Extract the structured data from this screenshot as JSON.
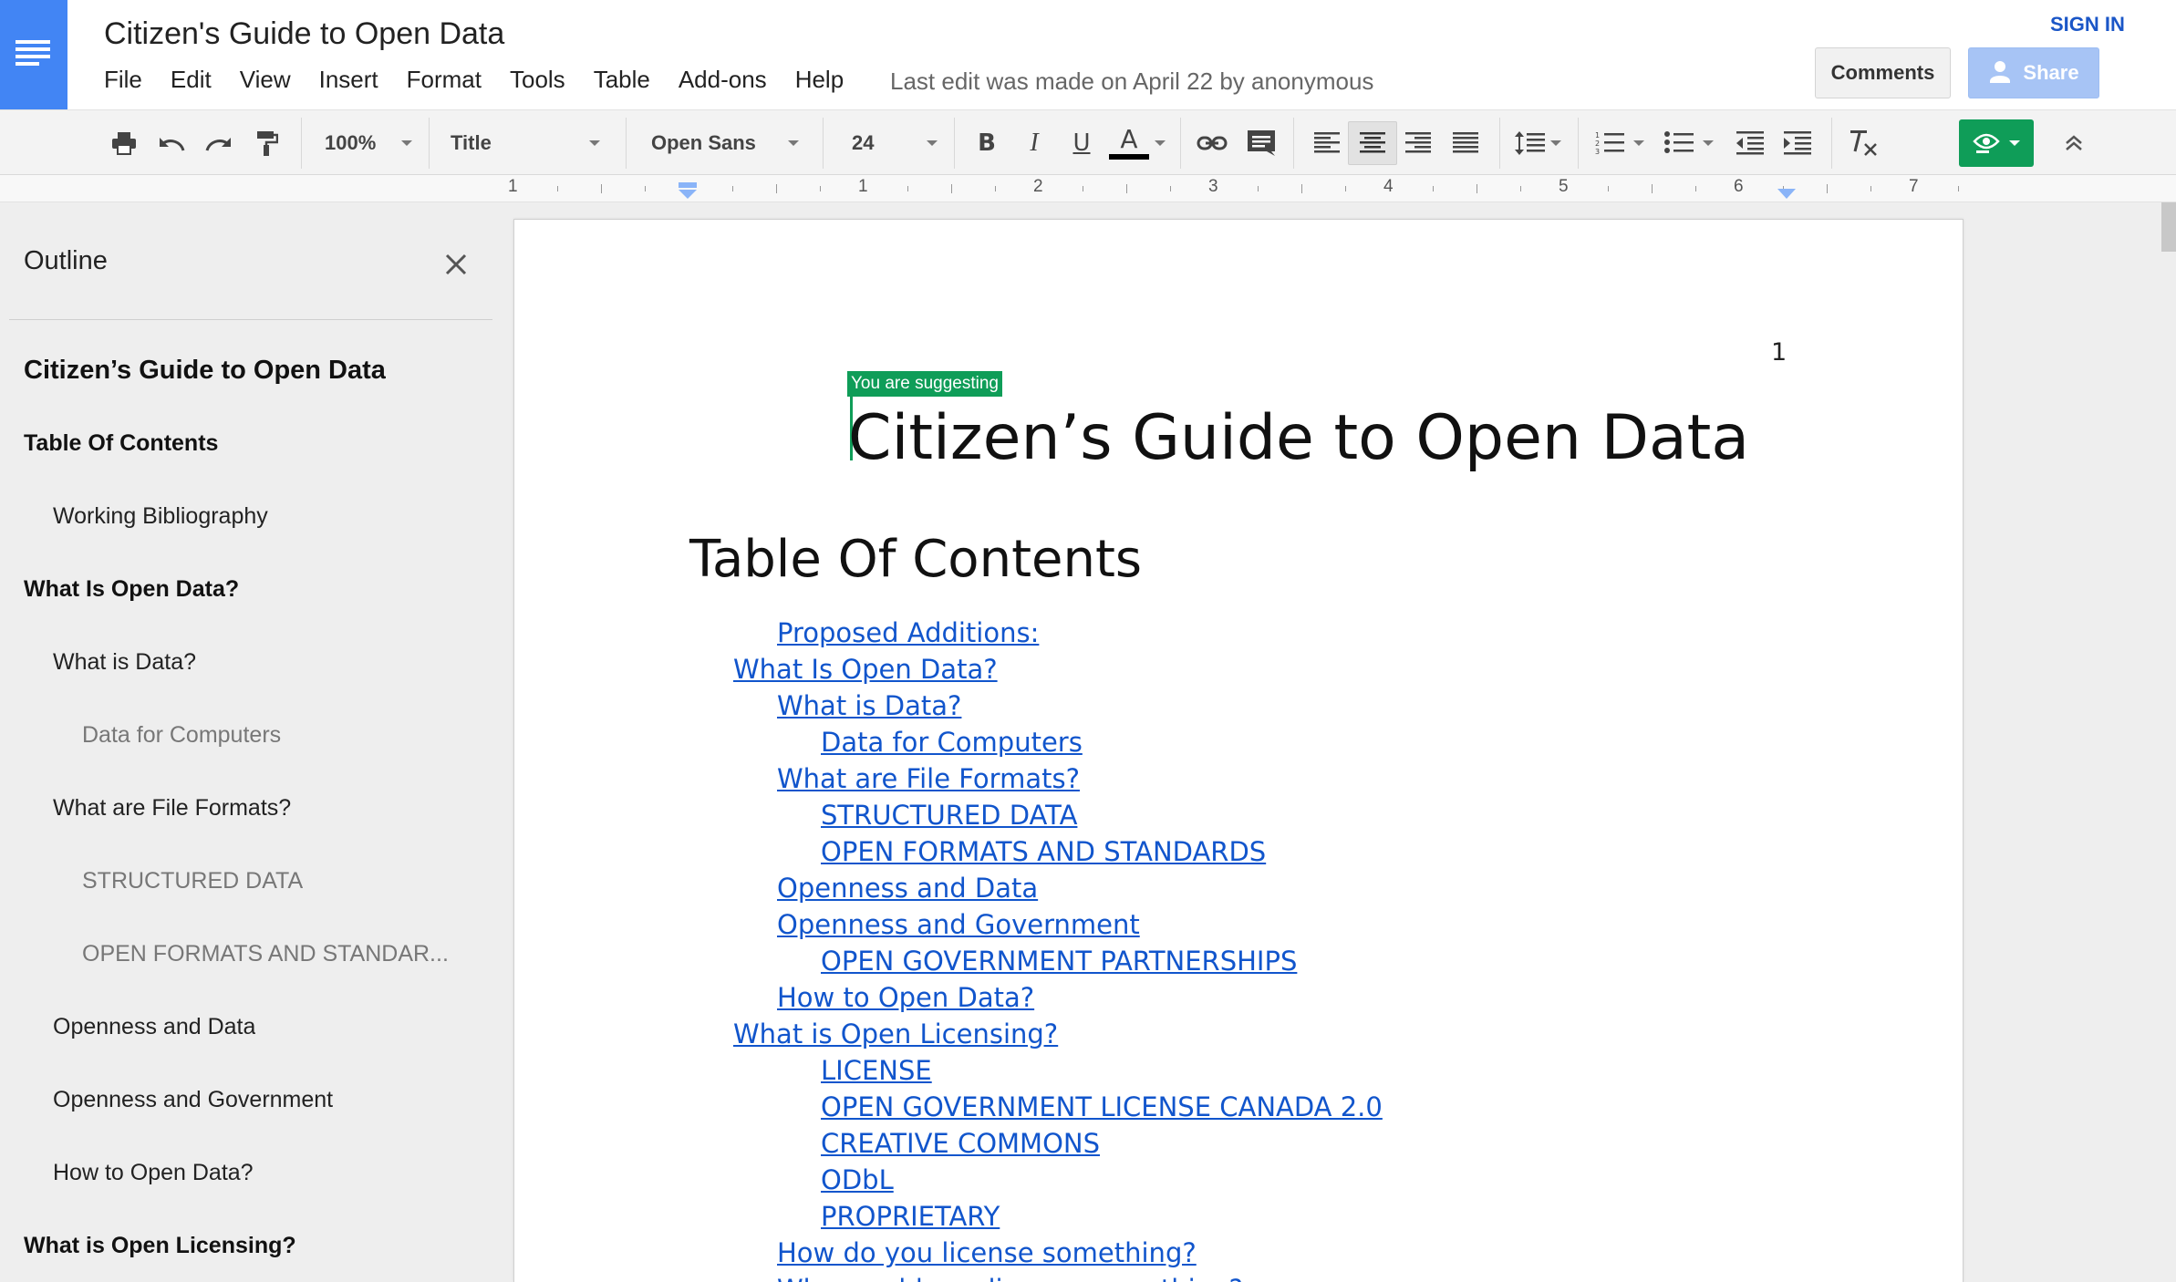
{
  "app": {
    "title": "Citizen's Guide to Open Data",
    "menu": [
      "File",
      "Edit",
      "View",
      "Insert",
      "Format",
      "Tools",
      "Table",
      "Add-ons",
      "Help"
    ],
    "last_edit": "Last edit was made on April 22 by anonymous",
    "sign_in": "SIGN IN",
    "comments_label": "Comments",
    "share_label": "Share",
    "logo_icon": "docs-lines-icon",
    "accent_color": "#4285f4",
    "suggest_color": "#0f9d58",
    "link_color": "#1155cc"
  },
  "toolbar": {
    "zoom": "100%",
    "style": "Title",
    "font": "Open Sans",
    "size": "24",
    "bold": "B",
    "italic": "I",
    "underline": "U",
    "text_color": "A",
    "icons": [
      "print-icon",
      "undo-icon",
      "redo-icon",
      "paint-format-icon",
      "link-icon",
      "comment-icon",
      "align-left-icon",
      "align-center-icon",
      "align-right-icon",
      "align-justify-icon",
      "line-spacing-icon",
      "numbered-list-icon",
      "bulleted-list-icon",
      "decrease-indent-icon",
      "increase-indent-icon",
      "clear-formatting-icon",
      "suggesting-mode-icon",
      "collapse-toolbar-icon"
    ]
  },
  "ruler": {
    "numbers": [
      "1",
      "1",
      "2",
      "3",
      "4",
      "5",
      "6",
      "7"
    ]
  },
  "outline": {
    "title": "Outline",
    "items": [
      {
        "label": "Citizen’s Guide to Open Data",
        "level": 0
      },
      {
        "label": "Table Of Contents",
        "level": 0
      },
      {
        "label": "Working Bibliography",
        "level": 1
      },
      {
        "label": "What Is Open Data?",
        "level": 0
      },
      {
        "label": "What is Data?",
        "level": 1
      },
      {
        "label": "Data for Computers",
        "level": 2
      },
      {
        "label": "What are File Formats?",
        "level": 1
      },
      {
        "label": "STRUCTURED DATA",
        "level": 2
      },
      {
        "label": "OPEN FORMATS AND STANDAR...",
        "level": 2
      },
      {
        "label": "Openness and Data",
        "level": 1
      },
      {
        "label": "Openness and Government",
        "level": 1
      },
      {
        "label": "How to Open Data?",
        "level": 1
      },
      {
        "label": "What is Open Licensing?",
        "level": 0
      }
    ]
  },
  "document": {
    "page_number": "1",
    "suggest_badge": "You are suggesting",
    "heading": "Citizen’s Guide to Open Data",
    "toc_heading": "Table Of Contents",
    "toc": [
      {
        "label": "Proposed Additions:",
        "level": 2
      },
      {
        "label": "What Is Open Data?",
        "level": 1
      },
      {
        "label": "What is Data?",
        "level": 2
      },
      {
        "label": "Data for Computers",
        "level": 3
      },
      {
        "label": "What are File Formats?",
        "level": 2
      },
      {
        "label": "STRUCTURED DATA",
        "level": 3
      },
      {
        "label": "OPEN FORMATS AND STANDARDS",
        "level": 3
      },
      {
        "label": "Openness and Data",
        "level": 2
      },
      {
        "label": "Openness and Government",
        "level": 2
      },
      {
        "label": "OPEN GOVERNMENT PARTNERSHIPS",
        "level": 3
      },
      {
        "label": "How to Open Data?",
        "level": 2
      },
      {
        "label": "What is Open Licensing?",
        "level": 1
      },
      {
        "label": "LICENSE",
        "level": 3
      },
      {
        "label": "OPEN GOVERNMENT LICENSE CANADA 2.0",
        "level": 3
      },
      {
        "label": "CREATIVE COMMONS",
        "level": 3
      },
      {
        "label": "ODbL",
        "level": 3
      },
      {
        "label": "PROPRIETARY",
        "level": 3
      },
      {
        "label": "How do you license something?",
        "level": 2
      },
      {
        "label": "Why would you license something?",
        "level": 2
      }
    ]
  }
}
